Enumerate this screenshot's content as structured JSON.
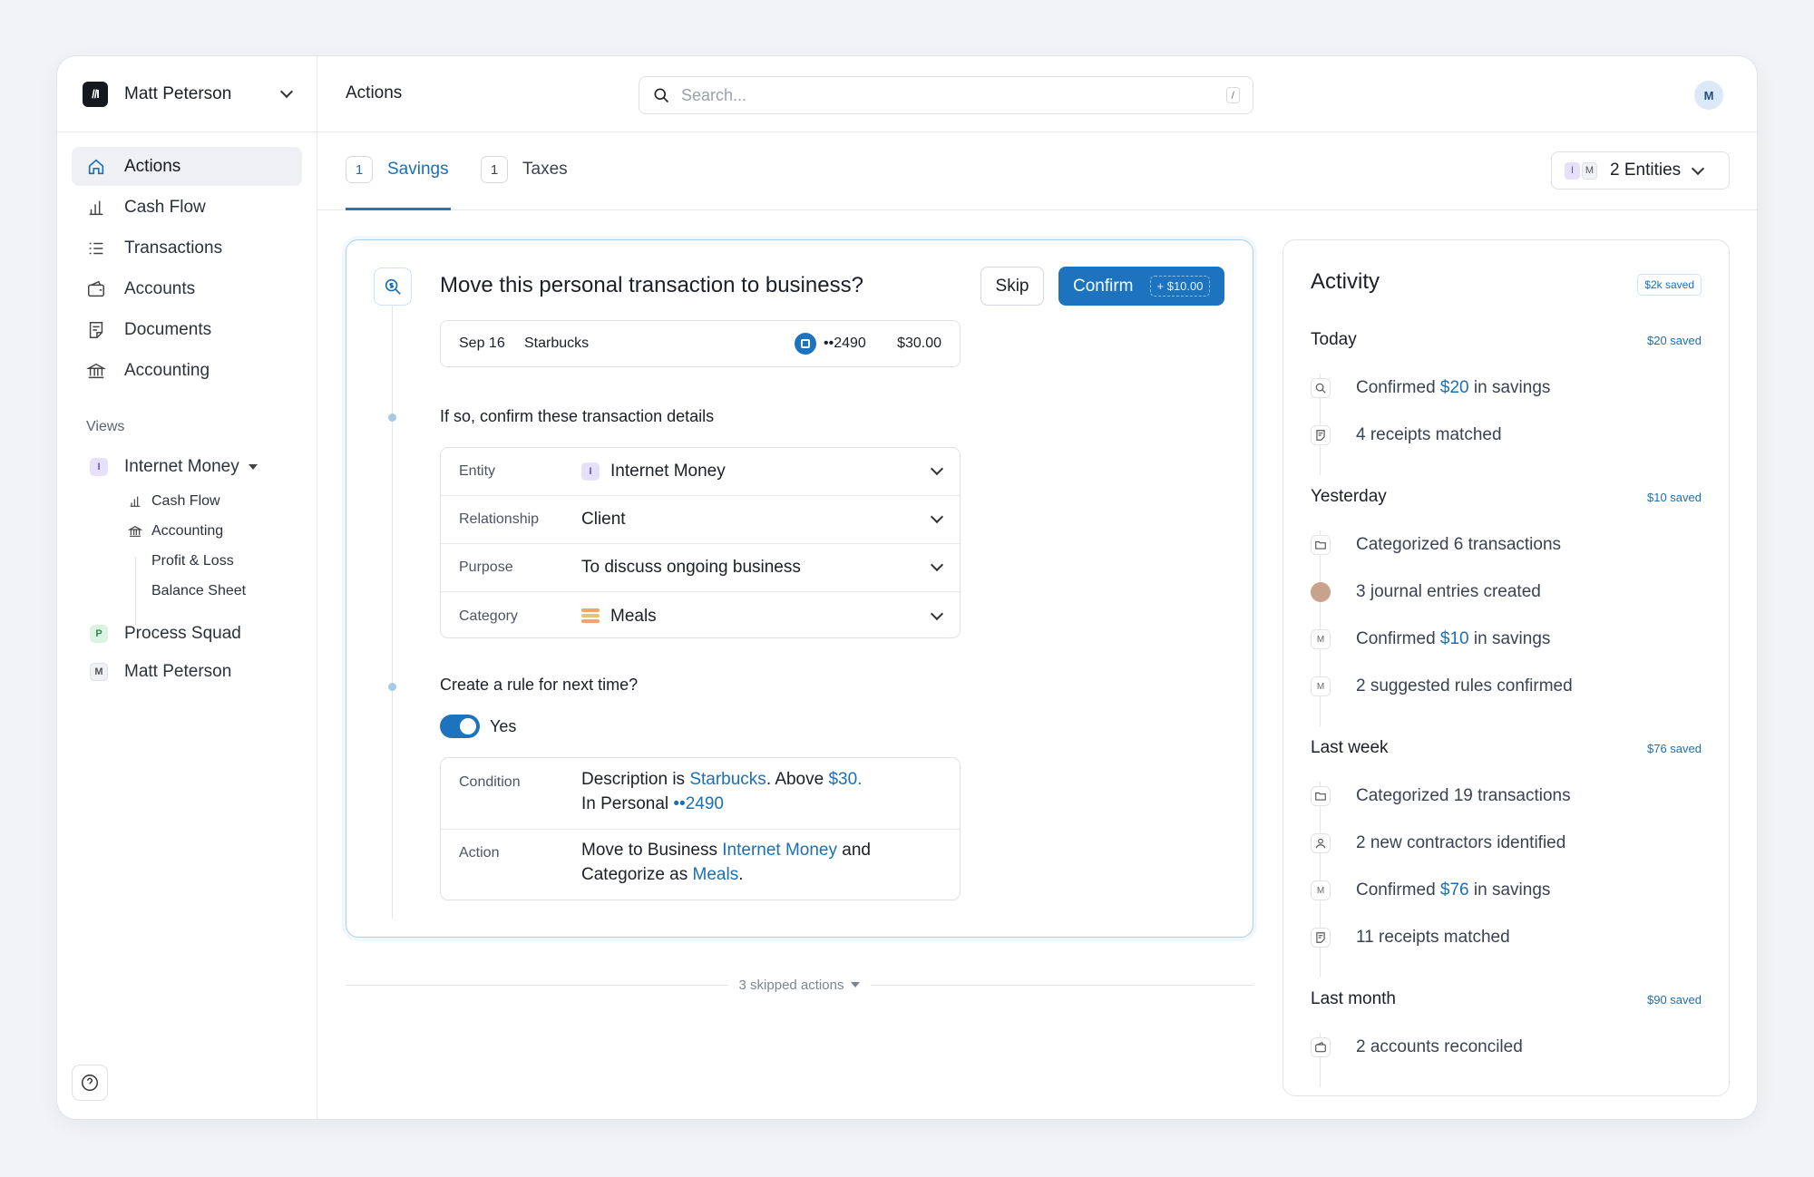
{
  "sidebar": {
    "logo_text": "//I",
    "user_name": "Matt Peterson",
    "nav": [
      {
        "label": "Actions",
        "icon": "home-icon"
      },
      {
        "label": "Cash Flow",
        "icon": "bar-chart-icon"
      },
      {
        "label": "Transactions",
        "icon": "list-icon"
      },
      {
        "label": "Accounts",
        "icon": "wallet-icon"
      },
      {
        "label": "Documents",
        "icon": "document-icon"
      },
      {
        "label": "Accounting",
        "icon": "bank-icon"
      }
    ],
    "views_label": "Views",
    "views": [
      {
        "badge": "I",
        "label": "Internet Money"
      },
      {
        "badge": "P",
        "label": "Process Squad"
      },
      {
        "badge": "M",
        "label": "Matt Peterson"
      }
    ],
    "subviews": [
      "Cash Flow",
      "Accounting",
      "Profit & Loss",
      "Balance Sheet"
    ]
  },
  "header": {
    "title": "Actions",
    "search_placeholder": "Search...",
    "search_shortcut": "/",
    "avatar": "M"
  },
  "tabs": [
    {
      "count": "1",
      "label": "Savings"
    },
    {
      "count": "1",
      "label": "Taxes"
    }
  ],
  "entities": {
    "badge1": "I",
    "badge2": "M",
    "label": "2 Entities"
  },
  "action_card": {
    "title": "Move this personal transaction to business?",
    "skip_label": "Skip",
    "confirm_label": "Confirm",
    "confirm_bonus": "+ $10.00",
    "transaction": {
      "date": "Sep 16",
      "merchant": "Starbucks",
      "account": "••2490",
      "amount": "$30.00"
    },
    "details_heading": "If so, confirm these transaction details",
    "fields": [
      {
        "label": "Entity",
        "value": "Internet Money",
        "badge": "I"
      },
      {
        "label": "Relationship",
        "value": "Client"
      },
      {
        "label": "Purpose",
        "value": "To discuss ongoing business"
      },
      {
        "label": "Category",
        "value": "Meals"
      }
    ],
    "rule_heading": "Create a rule for next time?",
    "toggle_label": "Yes",
    "condition": {
      "label": "Condition",
      "p1": "Description is ",
      "merchant": "Starbucks",
      "p2": ". Above ",
      "amount": "$30.",
      "p3": "In Personal ",
      "account": "••2490"
    },
    "action": {
      "label": "Action",
      "p1": "Move to Business ",
      "entity": "Internet Money",
      "p2": " and",
      "p3": "Categorize as ",
      "category": "Meals",
      "p4": "."
    }
  },
  "skipped_label": "3 skipped actions",
  "activity": {
    "title": "Activity",
    "total_saved": "$2k saved",
    "groups": [
      {
        "name": "Today",
        "saved": "$20 saved",
        "items": [
          {
            "icon": "search-dollar-icon",
            "glyph": "",
            "pre": "Confirmed ",
            "hl": "$20",
            "post": " in savings"
          },
          {
            "icon": "receipt-icon",
            "glyph": "",
            "pre": "4 receipts matched",
            "hl": "",
            "post": ""
          }
        ]
      },
      {
        "name": "Yesterday",
        "saved": "$10 saved",
        "items": [
          {
            "icon": "folder-icon",
            "glyph": "",
            "pre": "Categorized 6 transactions",
            "hl": "",
            "post": ""
          },
          {
            "icon": "user-photo-icon",
            "glyph": "",
            "pre": "3 journal entries created",
            "hl": "",
            "post": ""
          },
          {
            "icon": "initial-m-icon",
            "glyph": "M",
            "pre": "Confirmed ",
            "hl": "$10",
            "post": " in savings"
          },
          {
            "icon": "initial-m-icon",
            "glyph": "M",
            "pre": "2 suggested rules confirmed",
            "hl": "",
            "post": ""
          }
        ]
      },
      {
        "name": "Last week",
        "saved": "$76 saved",
        "items": [
          {
            "icon": "folder-icon",
            "glyph": "",
            "pre": "Categorized 19 transactions",
            "hl": "",
            "post": ""
          },
          {
            "icon": "person-icon",
            "glyph": "",
            "pre": "2 new contractors identified",
            "hl": "",
            "post": ""
          },
          {
            "icon": "initial-m-icon",
            "glyph": "M",
            "pre": "Confirmed ",
            "hl": "$76",
            "post": " in savings"
          },
          {
            "icon": "receipt-icon",
            "glyph": "",
            "pre": "11 receipts matched",
            "hl": "",
            "post": ""
          }
        ]
      },
      {
        "name": "Last month",
        "saved": "$90 saved",
        "items": [
          {
            "icon": "wallet-icon",
            "glyph": "",
            "pre": "2 accounts reconciled",
            "hl": "",
            "post": ""
          }
        ]
      }
    ]
  },
  "colors": {
    "accent": "#1d73bd",
    "link": "#1c6fb5",
    "border": "#dde1e6"
  }
}
